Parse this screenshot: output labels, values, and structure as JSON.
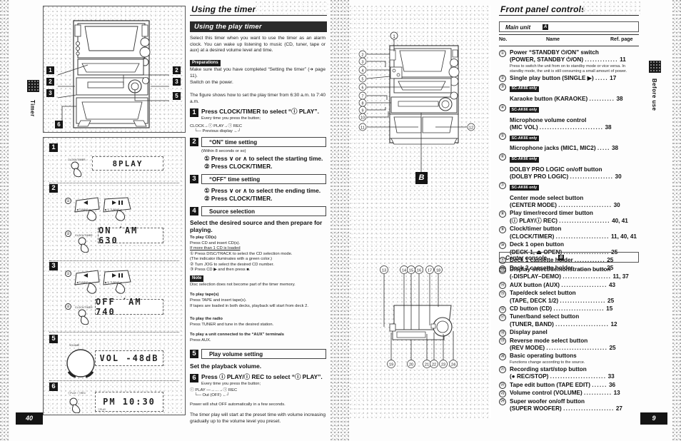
{
  "left_page": {
    "number": "40",
    "edge_tab": "Timer",
    "section_title": "Using the timer",
    "band_title": "Using the play timer",
    "intro": "Select this timer when you want to use the timer as an alarm clock. You can wake up listening to music (CD, tuner, tape or aux) at a desired volume level and time.",
    "preparations_label": "Preparations",
    "prep_items": [
      "Make sure that you have completed “Setting the timer” (➜ page 11).",
      "Switch on the power."
    ],
    "figure_note": "The figure shows how to set the play timer from 6:30 a.m. to 7:40 a.m.",
    "steps": [
      {
        "num": "1",
        "heading": "Press CLOCK/TIMER to select “ⓘ PLAY”.",
        "sub": "Every time you press the button;",
        "flow1": "CLOCK→ⓘ PLAY→ⓘ REC",
        "flow2": "└— Previous display ←┘"
      },
      {
        "num": "2",
        "boxlabel": "“ON” time setting",
        "note": "(Within 8 seconds or so)",
        "lines": [
          "① Press ∨ or ∧ to select the starting time.",
          "② Press CLOCK/TIMER."
        ]
      },
      {
        "num": "3",
        "boxlabel": "“OFF” time setting",
        "lines": [
          "① Press ∨ or ∧ to select the ending time.",
          "② Press CLOCK/TIMER."
        ]
      },
      {
        "num": "4",
        "boxlabel": "Source selection",
        "lead": "Select the desired source and then prepare for playing.",
        "groups": [
          {
            "title": "To play CD(s)",
            "lines": [
              "Press CD and insert CD(s).",
              "If more than 1 CD is loaded",
              "① Press DISC/TRACK to select the CD selection mode.",
              "   (The indicator illuminates with a green color.)",
              "② Turn JOG to select the desired CD number.",
              "③ Press CD ▶ and then press ■."
            ]
          },
          {
            "title": "Note",
            "is_note": true,
            "lines": [
              "Disc selection does not become part of the timer memory."
            ]
          },
          {
            "title": "To play tape(s)",
            "lines": [
              "Press TAPE and insert tape(s).",
              "If tapes are loaded in both decks, playback will start from deck 2."
            ]
          },
          {
            "title": "To play the radio",
            "lines": [
              "Press TUNER and tune in the desired station."
            ]
          },
          {
            "title": "To play a unit connected to the “AUX” terminals",
            "lines": [
              "Press AUX."
            ]
          }
        ]
      },
      {
        "num": "5",
        "boxlabel": "Play volume setting",
        "lead": "Set the playback volume."
      },
      {
        "num": "6",
        "heading": "Press ⓘ PLAY/ⓘ REC to select “ⓘ PLAY”.",
        "sub": "Every time you press the button;",
        "flow1": "ⓘ PLAY —→…→ⓘ REC",
        "flow2": "└— Out (OFF) ←┘",
        "after1": "Power will shut OFF automatically in a few seconds.",
        "after2": "The timer play will start at the preset time with volume increasing gradually up to the volume level you preset."
      }
    ],
    "illustration": {
      "step1_display": "8PLAY",
      "step1_btn_label": "CLOCK/TIMER",
      "step2_display": "ON  ˙AM  630",
      "step2_btn_label": "CLOCK/TIMER",
      "step2_key_left": "◀ TUNING  ∨",
      "step2_key_right": "▶/❙ TUNING ∧",
      "step3_display": "OFF ˙AM  740",
      "step3_btn_label": "CLOCK/TIMER",
      "step5_display": "VOL  -48dB",
      "step5_knob_label": "VOLUME",
      "step6_display": "PM 10:30",
      "step6_btn_label": "ⓘPLAY / ⓘREC",
      "step6_small": "ⓘPLAY",
      "callouts": [
        "1",
        "2",
        "3",
        "2",
        "3",
        "5",
        "6"
      ]
    }
  },
  "right_page": {
    "number": "9",
    "edge_tab": "Before use",
    "section_title": "Front panel controls",
    "figure_labels": {
      "top": "A",
      "bottom": "B"
    },
    "main_unit": {
      "label": "Main unit",
      "tag": "A"
    },
    "center_console": {
      "label": "Center console",
      "tag": "B"
    },
    "columns": {
      "no": "No.",
      "name": "Name",
      "ref": "Ref. page"
    },
    "only_tag": "SC-AK66 only",
    "main_unit_items": [
      {
        "num": "①",
        "lines": [
          "Power “STANDBY ⏻/ON” switch",
          "(POWER, STANDBY ⏻/ON)"
        ],
        "page": "11",
        "note": "Press to switch the unit from on to standby mode or vice versa. In standby mode, the unit is still consuming a small amount of power."
      },
      {
        "num": "②",
        "lines": [
          "Single play button (SINGLE ▶)"
        ],
        "page": "17"
      },
      {
        "num": "③",
        "tag": true,
        "lines": [
          "Karaoke button (KARAOKE)"
        ],
        "page": "38"
      },
      {
        "num": "④",
        "tag": true,
        "lines": [
          "Microphone volume control",
          "(MIC VOL)"
        ],
        "page": "38"
      },
      {
        "num": "⑤",
        "tag": true,
        "lines": [
          "Microphone jacks (MIC1, MIC2)"
        ],
        "page": "38"
      },
      {
        "num": "⑥",
        "tag": true,
        "lines": [
          "DOLBY PRO LOGIC on/off button",
          "(DOLBY PRO LOGIC)"
        ],
        "page": "30"
      },
      {
        "num": "⑦",
        "tag": true,
        "lines": [
          "Center mode select button",
          "(CENTER MODE)"
        ],
        "page": "30"
      },
      {
        "num": "⑧",
        "lines": [
          "Play timer/record timer button",
          "(ⓘ PLAY/ⓘ REC)"
        ],
        "page": "40, 41"
      },
      {
        "num": "⑨",
        "lines": [
          "Clock/timer button",
          "(CLOCK/TIMER)"
        ],
        "page": "11, 40, 41"
      },
      {
        "num": "⑩",
        "lines": [
          "Deck 1 open button",
          "(DECK 1, ⏏ OPEN)"
        ],
        "page": "25"
      },
      {
        "num": "⑪",
        "lines": [
          "Deck 1 cassette holder"
        ],
        "page": "25"
      },
      {
        "num": "⑫",
        "lines": [
          "Deck 2 cassette holder"
        ],
        "page": "25"
      }
    ],
    "center_console_items": [
      {
        "num": "⑬",
        "lines": [
          "Display select/demonstration button",
          "(-DISPLAY–DEMO)"
        ],
        "page": "11, 37"
      },
      {
        "num": "⑭",
        "lines": [
          "AUX button (AUX)"
        ],
        "page": "43"
      },
      {
        "num": "⑮",
        "lines": [
          "Tape/deck select button",
          "(TAPE, DECK 1/2)"
        ],
        "page": "25"
      },
      {
        "num": "⑯",
        "lines": [
          "CD button (CD)"
        ],
        "page": "15"
      },
      {
        "num": "⑰",
        "lines": [
          "Tuner/band select button",
          "(TUNER, BAND)"
        ],
        "page": "12"
      },
      {
        "num": "⑱",
        "lines": [
          "Display panel"
        ],
        "page": ""
      },
      {
        "num": "⑲",
        "lines": [
          "Reverse mode select button",
          "(REV MODE)"
        ],
        "page": "25"
      },
      {
        "num": "⑳",
        "lines": [
          "Basic operating buttons"
        ],
        "page": "",
        "note": "Functions change according to the source."
      },
      {
        "num": "㉑",
        "lines": [
          "Recording start/stop button",
          "(● REC/STOP)"
        ],
        "page": "33"
      },
      {
        "num": "㉒",
        "lines": [
          "Tape edit button (TAPE EDIT)"
        ],
        "page": "36"
      },
      {
        "num": "㉓",
        "lines": [
          "Volume control (VOLUME)"
        ],
        "page": "13"
      },
      {
        "num": "㉔",
        "lines": [
          "Super woofer on/off button",
          "(SUPER WOOFER)"
        ],
        "page": "27"
      }
    ],
    "diagram_a_callouts": [
      "1",
      "2",
      "3",
      "4",
      "5",
      "6",
      "7",
      "8",
      "9",
      "10",
      "11",
      "12"
    ],
    "diagram_b_callouts_top": [
      "13",
      "14",
      "15",
      "16",
      "17",
      "18"
    ],
    "diagram_b_callouts_bottom": [
      "19",
      "20",
      "21",
      "22",
      "23",
      "24"
    ]
  }
}
